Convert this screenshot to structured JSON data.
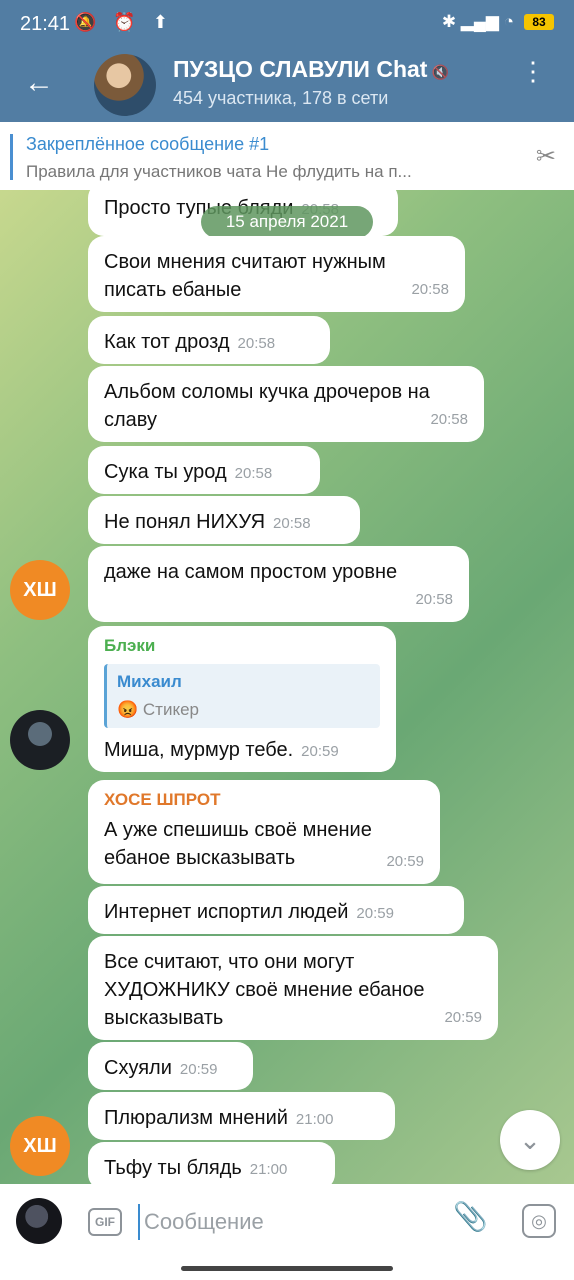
{
  "status": {
    "time": "21:41",
    "left_icons": "🔕 ⏰ ⬆",
    "right_icons": "✱ ▂▄▆ ◔",
    "battery": "83"
  },
  "header": {
    "back_icon": "←",
    "title": "ПУЗЦО СЛАВУЛИ Chat",
    "mute_icon": "🔇",
    "subtitle": "454 участника, 178 в сети",
    "menu_icon": "⋮"
  },
  "pinned": {
    "title": "Закреплённое сообщение #1",
    "text": "Правила для участников чата  Не флудить на п...",
    "unpin_icon": "✂"
  },
  "date_pill": "15 апреля 2021",
  "messages": [
    {
      "text": "Просто тупые бляди",
      "time": "20:58"
    },
    {
      "text": "Свои мнения считают нужным писать ебаные",
      "time": "20:58"
    },
    {
      "text": "Как тот дрозд",
      "time": "20:58"
    },
    {
      "text": "Альбом соломы кучка дрочеров на славу",
      "time": "20:58"
    },
    {
      "text": "Сука ты урод",
      "time": "20:58"
    },
    {
      "text": "Не понял НИХУЯ",
      "time": "20:58"
    },
    {
      "text": "даже на самом простом уровне",
      "time": "20:58"
    },
    {
      "sender": "Блэки",
      "sender_color": "#4caf50",
      "reply_name": "Михаил",
      "reply_text": "😡 Стикер",
      "text": "Миша, мурмур тебе.",
      "time": "20:59"
    },
    {
      "sender": "ХОСЕ ШПРОТ",
      "sender_color": "#e0782b",
      "text": "А уже спешишь своё мнение ебаное высказывать",
      "time": "20:59"
    },
    {
      "text": "Интернет испортил людей",
      "time": "20:59"
    },
    {
      "text": "Все считают, что они могут ХУДОЖНИКУ своё мнение ебаное высказывать",
      "time": "20:59"
    },
    {
      "text": "Схуяли",
      "time": "20:59"
    },
    {
      "text": "Плюрализм мнений",
      "time": "21:00"
    },
    {
      "text": "Тьфу ты блядь",
      "time": "21:00"
    }
  ],
  "avatars": {
    "xs_initials": "ХШ"
  },
  "composer": {
    "gif_label": "GIF",
    "placeholder": "Сообщение",
    "attach_icon": "📎",
    "camera_icon": "◎"
  },
  "scroll_icon": "⌄"
}
